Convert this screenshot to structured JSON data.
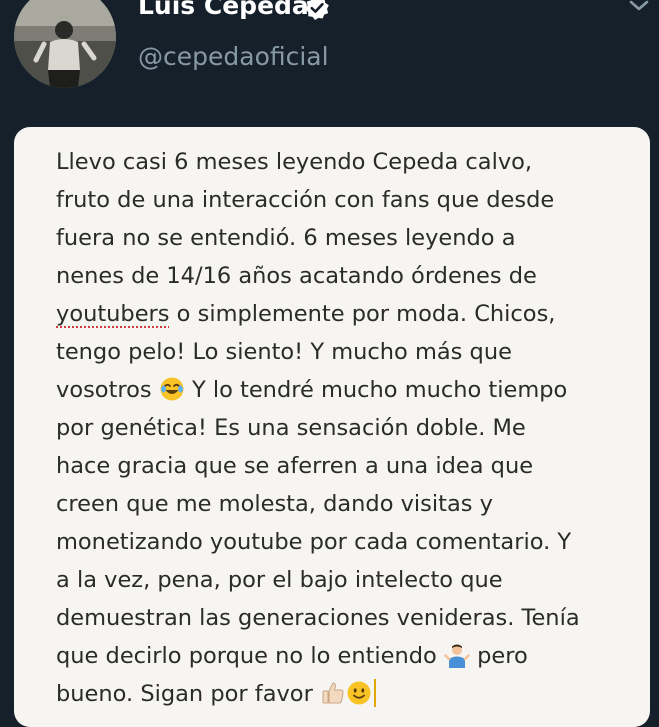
{
  "profile": {
    "display_name": "Luis Cepeda",
    "handle": "@cepedaoficial",
    "verified": true,
    "icons": {
      "verified": "verified-badge-icon",
      "menu": "chevron-down-icon"
    }
  },
  "note": {
    "lines": [
      "Llevo casi 6 meses leyendo Cepeda calvo,",
      "fruto de una interacción con fans que desde",
      "fuera no se entendió. 6 meses leyendo a",
      "nenes de 14/16 años acatando órdenes de",
      "youtubers",
      " o simplemente por moda. Chicos,",
      "tengo pelo! Lo siento! Y mucho más que",
      "vosotros ",
      " Y lo tendré mucho mucho tiempo",
      "por genética! Es una sensación doble. Me",
      "hace gracia que se aferren a una idea que",
      "creen que me molesta, dando visitas y",
      "monetizando youtube por cada comentario. Y",
      "a la vez, pena, por el bajo intelecto que",
      "demuestran las generaciones venideras. Tenía",
      "que decirlo porque no lo entiendo ",
      " pero",
      "bueno. Sigan por favor "
    ],
    "emojis": {
      "laugh": "face-with-tears-of-joy-emoji",
      "shrug": "person-shrugging-emoji",
      "thumbs": "thumbs-up-emoji",
      "smile": "slightly-smiling-face-emoji"
    }
  },
  "colors": {
    "background": "#15202b",
    "card": "#f6f5f1",
    "text": "#2b2b2b",
    "secondary": "#8899a6"
  }
}
